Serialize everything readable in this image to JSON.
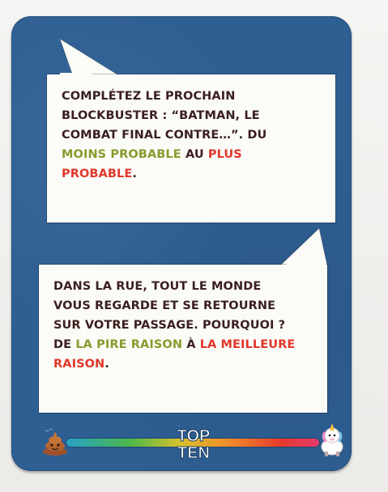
{
  "card": {
    "background_color": "#2e5f93",
    "prompt_1": {
      "line_1": "COMPLÉTEZ LE PROCHAIN",
      "line_2": "BLOCKBUSTER : “BATMAN, LE",
      "line_3": "COMBAT FINAL CONTRE…”. DU",
      "low_label": "MOINS PROBABLE",
      "connector": "AU",
      "high_label_a": "PLUS",
      "high_label_b": "PROBABLE",
      "end": "."
    },
    "prompt_2": {
      "line_1": "DANS LA RUE, TOUT LE MONDE",
      "line_2": "VOUS REGARDE ET SE RETOURNE",
      "line_3": "SUR VOTRE PASSAGE. POURQUOI ?",
      "prefix": "DE",
      "low_label": "LA PIRE RAISON",
      "connector": "À",
      "high_label_a": "LA MEILLEURE",
      "high_label_b": "RAISON",
      "end": "."
    },
    "colors": {
      "text": "#3a1f1e",
      "low": "#8a9a2c",
      "high": "#e1372a"
    },
    "scale": {
      "logo_top": "TOP",
      "logo_bottom": "TEN",
      "left_icon": "poop-icon",
      "right_icon": "unicorn-icon"
    }
  }
}
